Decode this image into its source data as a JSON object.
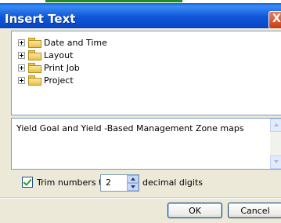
{
  "window": {
    "title": "Insert Text",
    "close_label": "X"
  },
  "tree": {
    "items": [
      {
        "label": "Date and Time"
      },
      {
        "label": "Layout"
      },
      {
        "label": "Print Job"
      },
      {
        "label": "Project"
      }
    ]
  },
  "description": {
    "text": "Yield Goal and Yield -Based Management Zone maps"
  },
  "trim": {
    "label": "Trim numbers to",
    "checked": true,
    "value": "2",
    "suffix": "decimal digits"
  },
  "buttons": {
    "ok": "OK",
    "cancel": "Cancel"
  }
}
